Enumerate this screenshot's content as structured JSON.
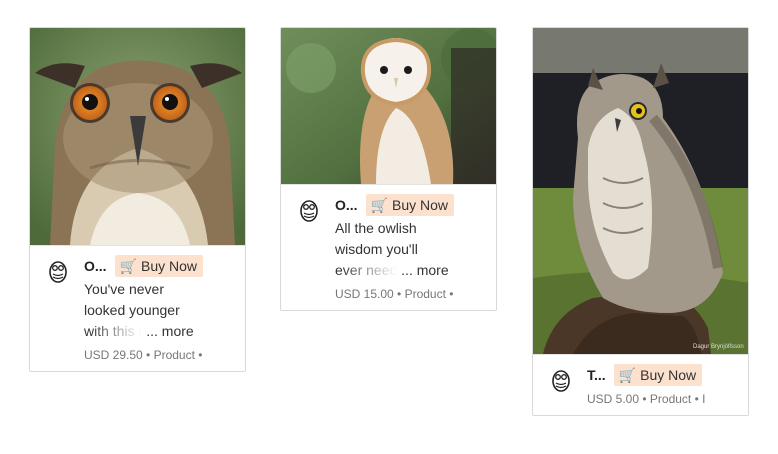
{
  "cards": [
    {
      "title": "O...",
      "buy_label": "Buy Now",
      "cart_icon": "shopping-cart-icon",
      "desc_lines": [
        "You've never",
        "looked younger"
      ],
      "desc_last": "with this t",
      "more_label": "... more",
      "meta": "USD 29.50 • Product •",
      "image": "eagle-owl-closeup"
    },
    {
      "title": "O...",
      "buy_label": "Buy Now",
      "cart_icon": "shopping-cart-icon",
      "desc_lines": [
        "All the owlish",
        "wisdom you'll"
      ],
      "desc_last": "ever need",
      "more_label": "... more",
      "meta": "USD 15.00 • Product •",
      "image": "barn-owl"
    },
    {
      "title": "T...",
      "buy_label": "Buy Now",
      "cart_icon": "shopping-cart-icon",
      "meta": "USD 5.00 • Product • I",
      "image": "great-horned-owl-on-glove",
      "photo_credit": "Dagur Brynjólfsson"
    }
  ],
  "colors": {
    "buy_bg": "#fde1cf",
    "border": "#d9d9d9",
    "meta": "#777777"
  }
}
